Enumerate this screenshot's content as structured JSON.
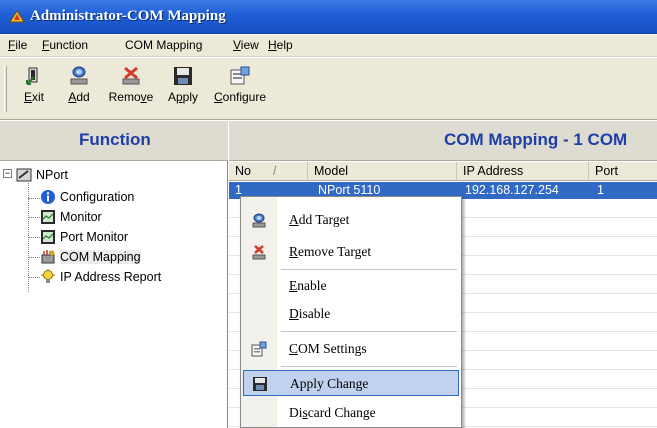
{
  "window": {
    "title": "Administrator-COM Mapping"
  },
  "menubar": {
    "items": [
      {
        "pre": "",
        "ul": "F",
        "post": "ile"
      },
      {
        "pre": "",
        "ul": "F",
        "post": "unction"
      },
      {
        "pre": "COM Mappin",
        "ul": "g",
        "post": ""
      },
      {
        "pre": "",
        "ul": "V",
        "post": "iew"
      },
      {
        "pre": "",
        "ul": "H",
        "post": "elp"
      }
    ]
  },
  "toolbar": {
    "exit": {
      "ul": "E",
      "rest": "xit"
    },
    "add": {
      "ul": "A",
      "rest": "dd"
    },
    "remove": {
      "pre": "Remo",
      "ul": "v",
      "post": "e"
    },
    "apply": {
      "pre": "A",
      "ul": "p",
      "post": "ply"
    },
    "configure": {
      "ul": "C",
      "rest": "onfigure"
    }
  },
  "function_panel": {
    "header": "Function",
    "tree": {
      "root": "NPort",
      "children": [
        "Configuration",
        "Monitor",
        "Port Monitor",
        "COM Mapping",
        "IP Address Report"
      ]
    }
  },
  "com_panel": {
    "header": "COM Mapping - 1 COM",
    "columns": [
      "No",
      "Model",
      "IP Address",
      "Port"
    ],
    "sort_indicator": "/",
    "rows": [
      {
        "no": "1",
        "model": "NPort 5110",
        "ip": "192.168.127.254",
        "port": "1"
      }
    ]
  },
  "context_menu": {
    "items": [
      {
        "ul": "A",
        "rest": "dd Target",
        "icon": "add-target-icon"
      },
      {
        "ul": "R",
        "rest": "emove Target",
        "icon": "remove-target-icon"
      },
      {
        "ul": "E",
        "rest": "nable",
        "icon": ""
      },
      {
        "ul": "D",
        "rest": "isable",
        "icon": ""
      },
      {
        "ul": "C",
        "rest": "OM Settings",
        "icon": "com-settings-icon"
      },
      {
        "pre": "Apply Chan",
        "ul": "g",
        "post": "e",
        "icon": "save-disk-icon",
        "highlighted": true
      },
      {
        "pre": "Di",
        "ul": "s",
        "post": "card Change",
        "icon": ""
      }
    ]
  },
  "colors": {
    "title_bar": "#1f5fd6",
    "panel_header_text": "#1f3fa8",
    "selection": "#316ac5",
    "menu_highlight": "#c1d2ee"
  }
}
